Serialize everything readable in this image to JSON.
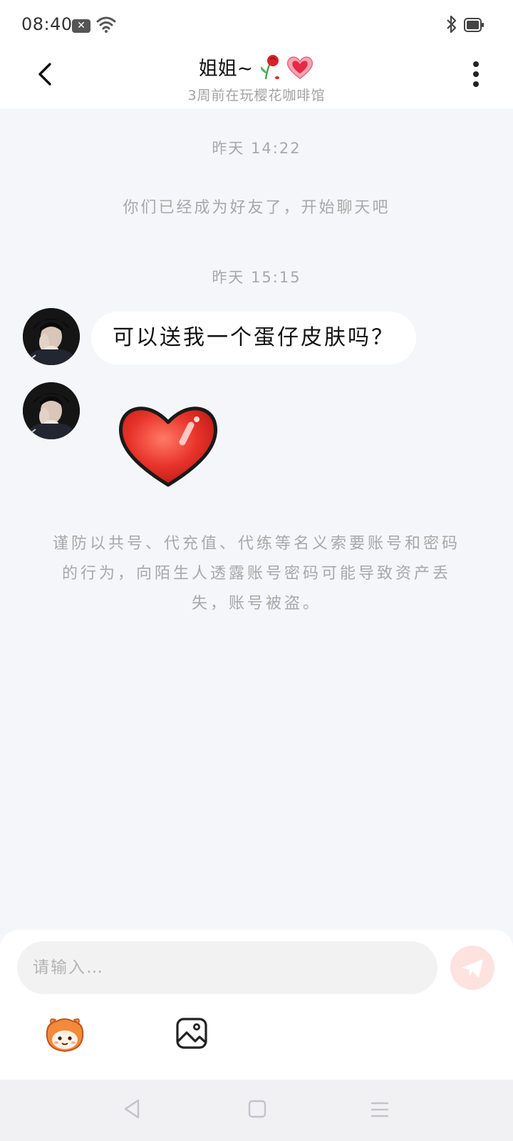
{
  "status_bar": {
    "time": "08:40",
    "icons": [
      "notification-icon",
      "wifi-icon",
      "bluetooth-icon",
      "battery-icon"
    ]
  },
  "header": {
    "title": "姐姐~",
    "title_emojis": [
      "rose-icon",
      "heart-icon"
    ],
    "subtitle": "3周前在玩樱花咖啡馆",
    "back_icon": "chevron-left-icon",
    "more_icon": "more-vertical-icon"
  },
  "chat": {
    "timestamp_1": "昨天 14:22",
    "system_message": "你们已经成为好友了，开始聊天吧",
    "timestamp_2": "昨天 15:15",
    "messages": [
      {
        "type": "text",
        "text": "可以送我一个蛋仔皮肤吗？"
      },
      {
        "type": "sticker",
        "sticker": "red-heart-sticker"
      }
    ],
    "warning": "谨防以共号、代充值、代练等名义索要账号和密码的行为，向陌生人透露账号密码可能导致资产丢失，账号被盗。"
  },
  "input": {
    "placeholder": "请输入…",
    "send_icon": "paper-plane-icon",
    "tools": [
      "emoji-mascot-icon",
      "image-icon"
    ]
  },
  "nav_bar": {
    "icons": [
      "nav-back-icon",
      "nav-home-icon",
      "nav-menu-icon"
    ]
  },
  "colors": {
    "chat_background": "#f4f6f9",
    "muted_text": "#a8a8a8",
    "send_button": "#fde2df",
    "heart_red": "#e8332a"
  }
}
